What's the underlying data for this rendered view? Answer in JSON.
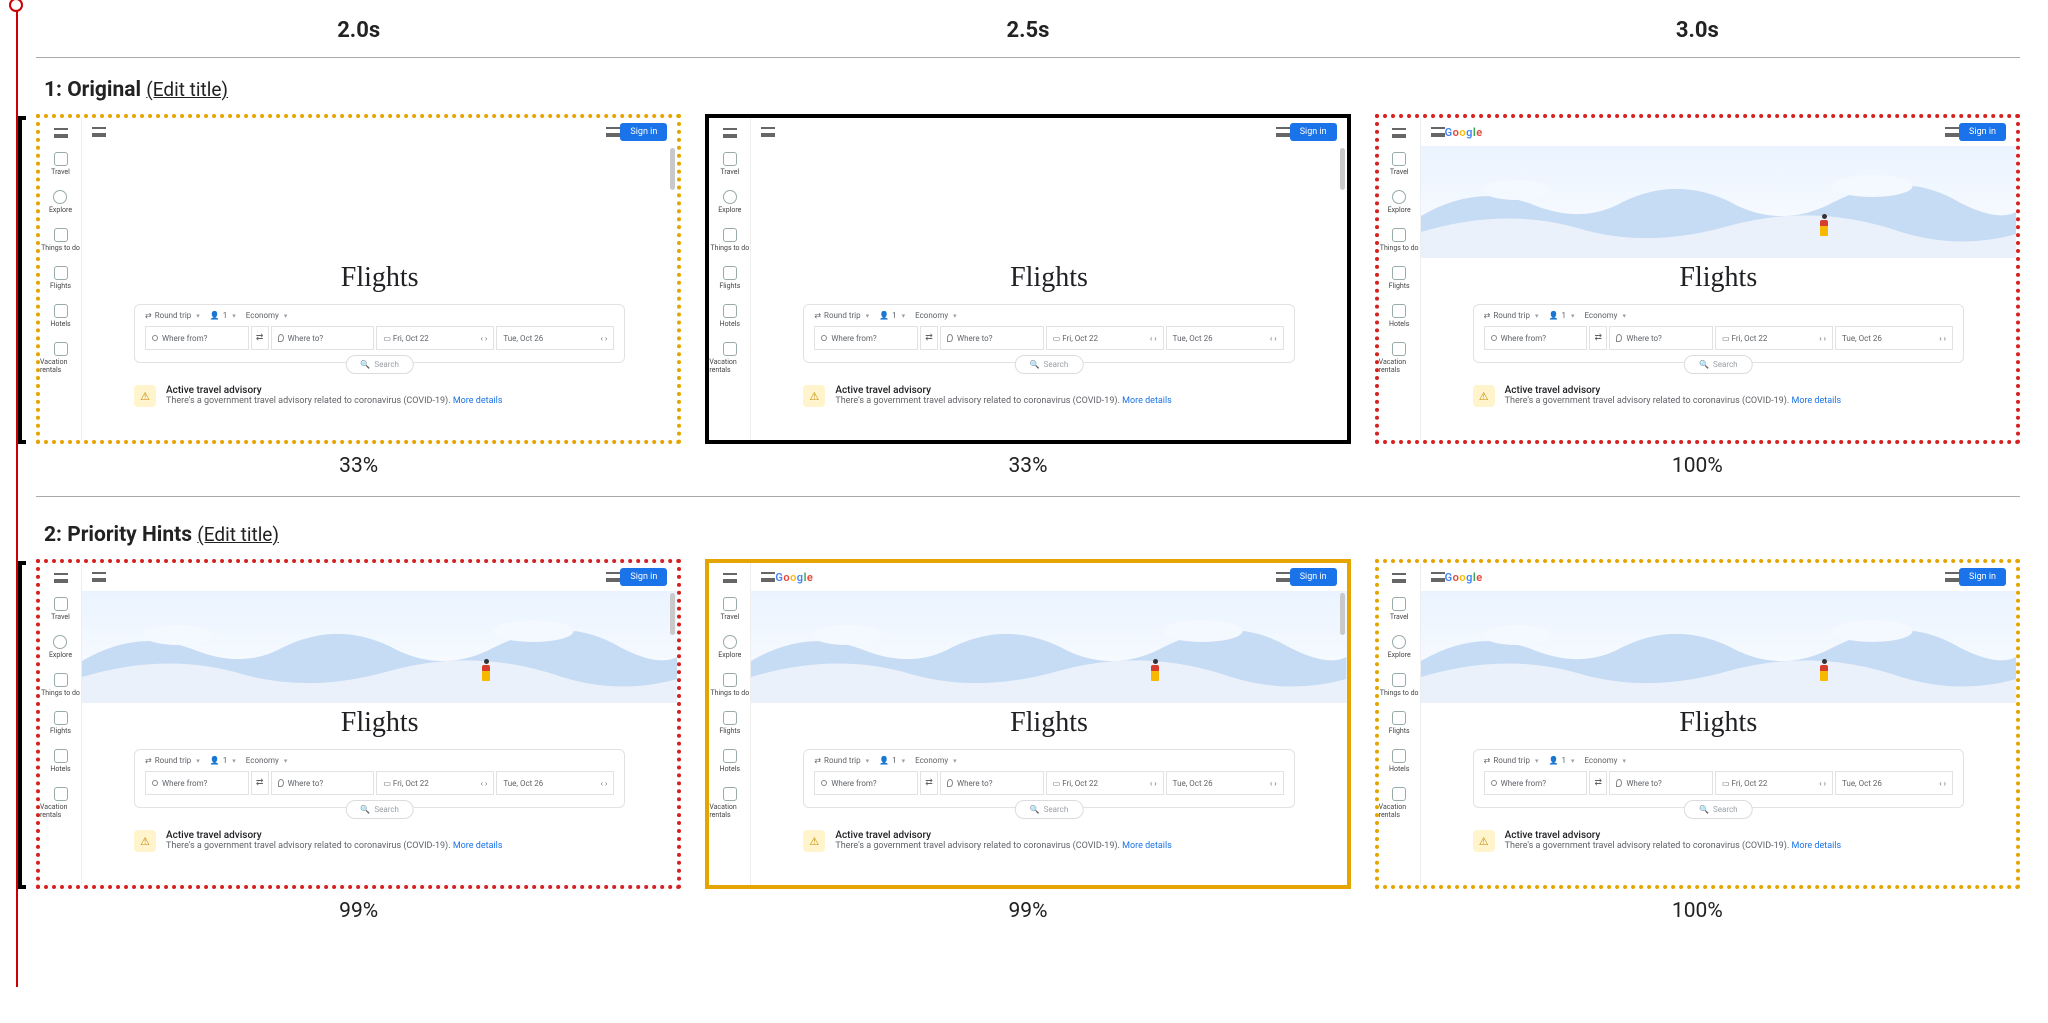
{
  "timesteps": [
    "2.0s",
    "2.5s",
    "3.0s"
  ],
  "edit_title_label": "(Edit title)",
  "rows": [
    {
      "index": "1",
      "label": "Original",
      "cells": [
        {
          "pct": "33%",
          "border": "b-dot-orange",
          "hero": "blank",
          "show_logo": false,
          "show_scroll": true
        },
        {
          "pct": "33%",
          "border": "b-solid-black",
          "hero": "blank",
          "show_logo": false,
          "show_scroll": true
        },
        {
          "pct": "100%",
          "border": "b-dot-red",
          "hero": "illus",
          "show_logo": true,
          "show_scroll": false
        }
      ]
    },
    {
      "index": "2",
      "label": "Priority Hints",
      "cells": [
        {
          "pct": "99%",
          "border": "b-dot-red",
          "hero": "illus",
          "show_logo": false,
          "show_scroll": true
        },
        {
          "pct": "99%",
          "border": "b-solid-orange",
          "hero": "illus",
          "show_logo": true,
          "show_scroll": true
        },
        {
          "pct": "100%",
          "border": "b-dot-orange",
          "hero": "illus",
          "show_logo": true,
          "show_scroll": false
        }
      ]
    }
  ],
  "mock": {
    "logo_text": "Google",
    "signin": "Sign in",
    "title": "Flights",
    "sidebar": [
      "Travel",
      "Explore",
      "Things to do",
      "Flights",
      "Hotels",
      "Vacation rentals"
    ],
    "trip_type": "Round trip",
    "pax": "1",
    "cabin": "Economy",
    "from_ph": "Where from?",
    "to_ph": "Where to?",
    "date1": "Fri, Oct 22",
    "date2": "Tue, Oct 26",
    "search": "Search",
    "advisory_title": "Active travel advisory",
    "advisory_sub": "There's a government travel advisory related to coronavirus (COVID-19).",
    "advisory_more": "More details"
  },
  "colors": {
    "timeline": "#c00",
    "dot_orange": "#e6a400",
    "dot_red": "#d62121",
    "signin_blue": "#1a73e8"
  }
}
